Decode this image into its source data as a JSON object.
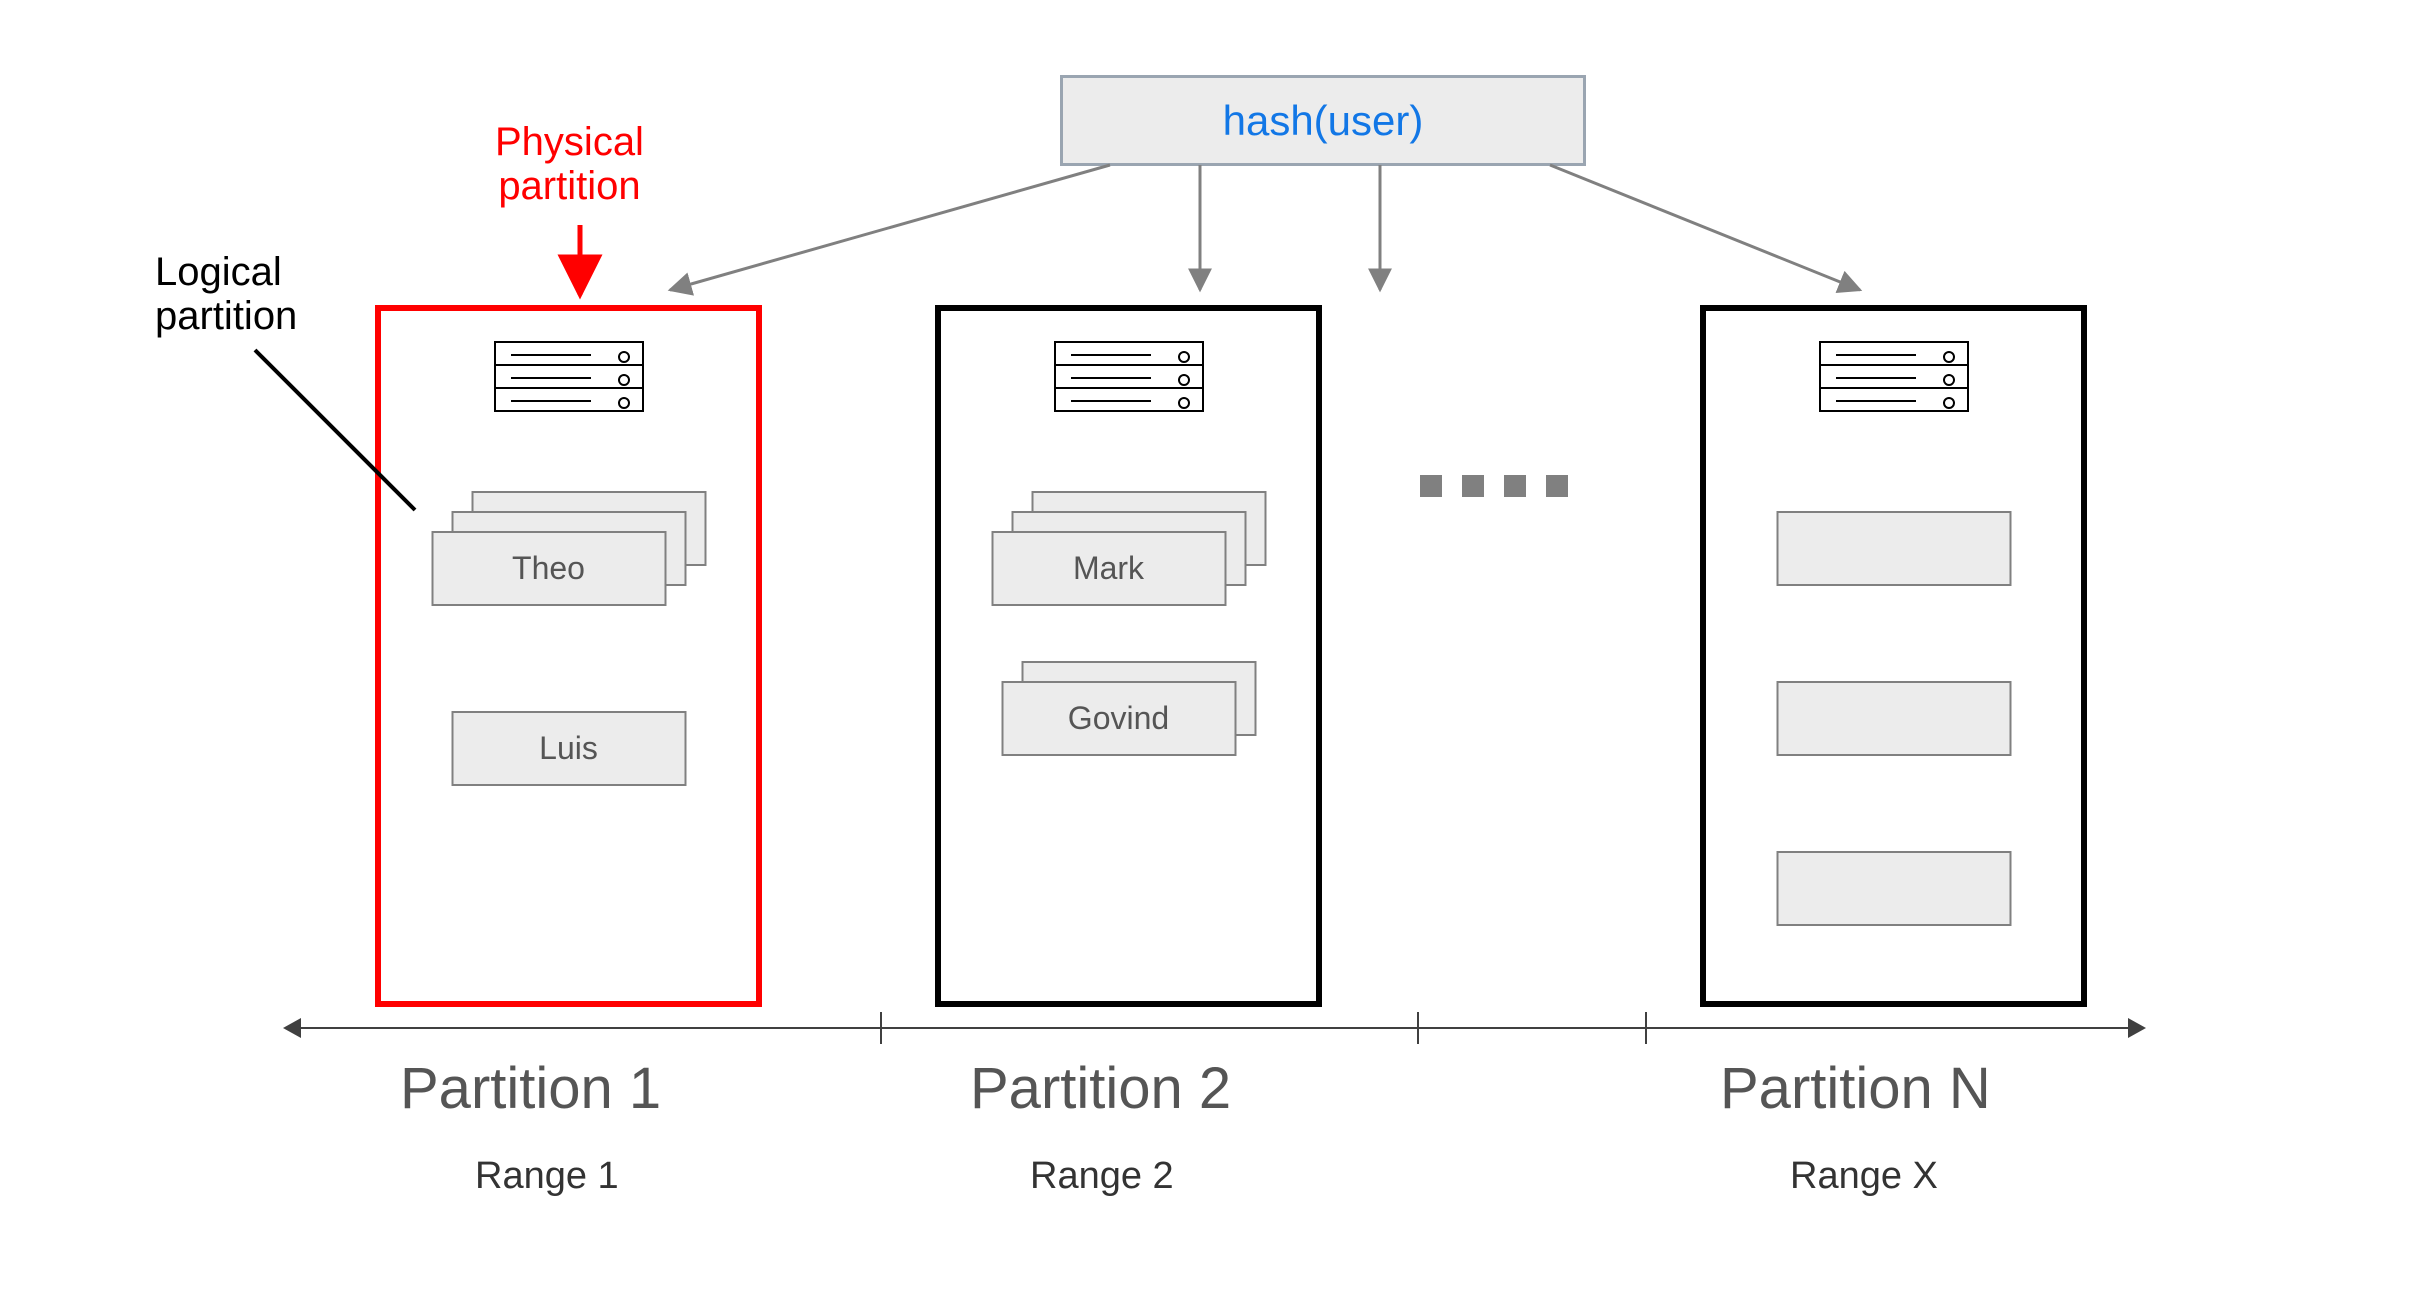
{
  "hash_label": "hash(user)",
  "callouts": {
    "physical": "Physical\npartition",
    "logical": "Logical\npartition"
  },
  "partitions": [
    {
      "id": "p1",
      "title": "Partition 1",
      "range": "Range 1",
      "border_color": "#FF0000",
      "is_physical_example": true,
      "records": [
        {
          "name": "Theo",
          "stack_depth": 3
        },
        {
          "name": "Luis",
          "stack_depth": 1
        }
      ]
    },
    {
      "id": "p2",
      "title": "Partition 2",
      "range": "Range 2",
      "border_color": "#000000",
      "records": [
        {
          "name": "Mark",
          "stack_depth": 3
        },
        {
          "name": "Govind",
          "stack_depth": 2
        }
      ]
    },
    {
      "id": "pN",
      "title": "Partition N",
      "range": "Range X",
      "border_color": "#000000",
      "records": [
        {
          "name": "",
          "stack_depth": 1
        },
        {
          "name": "",
          "stack_depth": 1
        },
        {
          "name": "",
          "stack_depth": 1
        }
      ]
    }
  ],
  "ellipsis_dots": 4
}
